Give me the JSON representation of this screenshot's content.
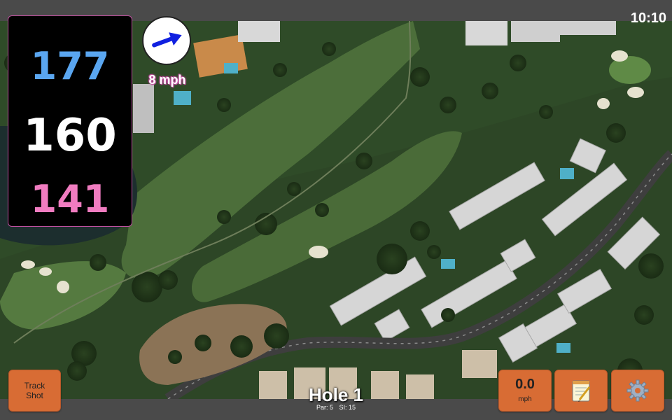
{
  "status": {
    "time": "10:10"
  },
  "yardages": {
    "back": "177",
    "center": "160",
    "front": "141"
  },
  "wind": {
    "speed_label": "8 mph",
    "direction_icon": "arrow-icon"
  },
  "buttons": {
    "track_shot_line1": "Track",
    "track_shot_line2": "Shot",
    "speed_value": "0.0",
    "speed_unit": "mph",
    "notes_icon": "notepad-icon",
    "settings_icon": "gear-icon"
  },
  "hole": {
    "title": "Hole 1",
    "par": "Par: 5",
    "si": "SI: 15"
  },
  "colors": {
    "back": "#5aa6f0",
    "center": "#ffffff",
    "front": "#f07cc0",
    "button": "#d86c34",
    "accent_border": "#c050a0"
  }
}
